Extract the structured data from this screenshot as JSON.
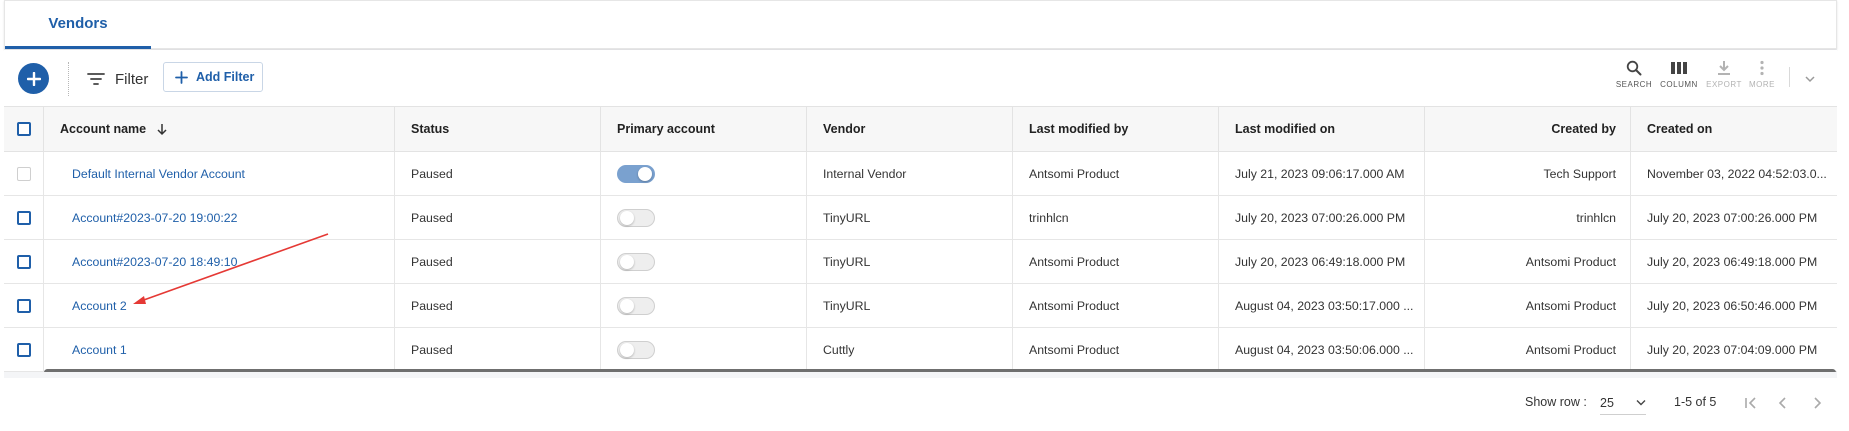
{
  "tabs": [
    {
      "label": "Vendors",
      "active": true
    }
  ],
  "toolbar": {
    "filter_label": "Filter",
    "add_filter_label": "Add Filter",
    "actions": [
      {
        "label": "SEARCH",
        "icon": "search-icon",
        "enabled": true
      },
      {
        "label": "COLUMN",
        "icon": "column-icon",
        "enabled": true
      },
      {
        "label": "EXPORT",
        "icon": "download-icon",
        "enabled": false
      },
      {
        "label": "MORE",
        "icon": "more-vertical-icon",
        "enabled": false
      }
    ]
  },
  "table": {
    "columns": [
      "Account name",
      "Status",
      "Primary account",
      "Vendor",
      "Last modified by",
      "Last modified on",
      "Created by",
      "Created on"
    ],
    "sort": {
      "column": "Account name",
      "direction": "desc"
    },
    "rows": [
      {
        "account_name": "Default Internal Vendor Account",
        "status": "Paused",
        "primary_account": true,
        "vendor": "Internal Vendor",
        "last_modified_by": "Antsomi Product",
        "last_modified_on": "July 21, 2023 09:06:17.000 AM",
        "created_by": "Tech Support",
        "created_on": "November 03, 2022 04:52:03.0...",
        "selectable": false
      },
      {
        "account_name": "Account#2023-07-20 19:00:22",
        "status": "Paused",
        "primary_account": false,
        "vendor": "TinyURL",
        "last_modified_by": "trinhlcn",
        "last_modified_on": "July 20, 2023 07:00:26.000 PM",
        "created_by": "trinhlcn",
        "created_on": "July 20, 2023 07:00:26.000 PM",
        "selectable": true
      },
      {
        "account_name": "Account#2023-07-20 18:49:10",
        "status": "Paused",
        "primary_account": false,
        "vendor": "TinyURL",
        "last_modified_by": "Antsomi Product",
        "last_modified_on": "July 20, 2023 06:49:18.000 PM",
        "created_by": "Antsomi Product",
        "created_on": "July 20, 2023 06:49:18.000 PM",
        "selectable": true
      },
      {
        "account_name": "Account 2",
        "status": "Paused",
        "primary_account": false,
        "vendor": "TinyURL",
        "last_modified_by": "Antsomi Product",
        "last_modified_on": "August 04, 2023 03:50:17.000 ...",
        "created_by": "Antsomi Product",
        "created_on": "July 20, 2023 06:50:46.000 PM",
        "selectable": true
      },
      {
        "account_name": "Account 1",
        "status": "Paused",
        "primary_account": false,
        "vendor": "Cuttly",
        "last_modified_by": "Antsomi Product",
        "last_modified_on": "August 04, 2023 03:50:06.000 ...",
        "created_by": "Antsomi Product",
        "created_on": "July 20, 2023 07:04:09.000 PM",
        "selectable": true
      }
    ]
  },
  "footer": {
    "show_row_label": "Show row :",
    "rows_per_page": "25",
    "range_label": "1-5 of 5"
  },
  "colors": {
    "accent": "#1f5fa9",
    "annotation_arrow": "#e53935"
  }
}
